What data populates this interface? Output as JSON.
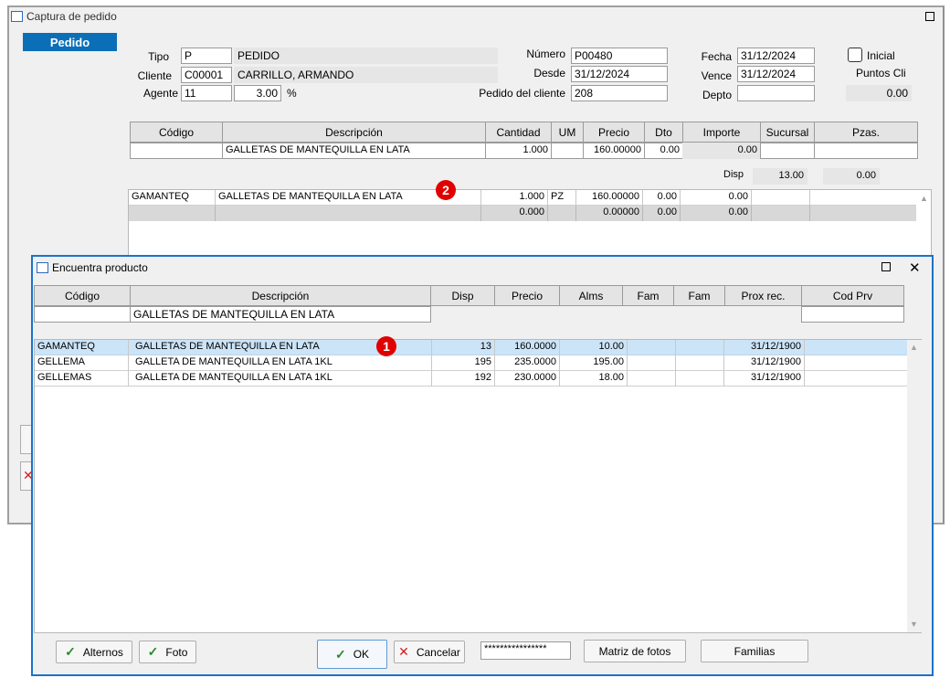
{
  "back_window": {
    "title": "Captura de pedido",
    "pedido_button": "Pedido",
    "tipo": {
      "label": "Tipo",
      "code": "P",
      "name": "PEDIDO"
    },
    "cliente": {
      "label": "Cliente",
      "code": "C00001",
      "name": "CARRILLO, ARMANDO"
    },
    "agente": {
      "label": "Agente",
      "code": "11",
      "pct": "3.00",
      "pct_sign": "%"
    },
    "numero": {
      "label": "Número",
      "value": "P00480"
    },
    "desde": {
      "label": "Desde",
      "value": "31/12/2024"
    },
    "pedido_cliente": {
      "label": "Pedido del cliente",
      "value": "208"
    },
    "fecha": {
      "label": "Fecha",
      "value": "31/12/2024"
    },
    "vence": {
      "label": "Vence",
      "value": "31/12/2024"
    },
    "depto": {
      "label": "Depto",
      "value": ""
    },
    "inicial": {
      "label": "Inicial",
      "checked": false
    },
    "puntos": {
      "label": "Puntos Cli",
      "value": "0.00"
    },
    "grid_headers": [
      "Código",
      "Descripción",
      "Cantidad",
      "UM",
      "Precio",
      "Dto",
      "Importe",
      "Sucursal",
      "Pzas."
    ],
    "entry_row": {
      "codigo": "",
      "descripcion": "GALLETAS  DE MANTEQUILLA EN LATA",
      "cantidad": "1.000",
      "um": "",
      "precio": "160.00000",
      "dto": "0.00",
      "importe": "0.00",
      "sucursal": "",
      "pzas": ""
    },
    "disp": {
      "label": "Disp",
      "value1": "13.00",
      "value2": "0.00"
    },
    "lines": [
      {
        "codigo": "GAMANTEQ",
        "descripcion": "GALLETAS  DE MANTEQUILLA EN LATA",
        "cantidad": "1.000",
        "um": "PZ",
        "precio": "160.00000",
        "dto": "0.00",
        "importe": "0.00"
      },
      {
        "codigo": "",
        "descripcion": "",
        "cantidad": "0.000",
        "um": "",
        "precio": "0.00000",
        "dto": "0.00",
        "importe": "0.00"
      }
    ],
    "badge": "2"
  },
  "front_window": {
    "title": "Encuentra producto",
    "headers": [
      "Código",
      "Descripción",
      "Disp",
      "Precio",
      "Alms",
      "Fam",
      "Fam",
      "Prox rec.",
      "Cod Prv"
    ],
    "filter_descripcion": "GALLETAS  DE MANTEQUILLA EN LATA",
    "rows": [
      {
        "codigo": "GAMANTEQ",
        "descripcion": "GALLETAS  DE MANTEQUILLA EN LATA",
        "disp": "13",
        "precio": "160.0000",
        "alms": "10.00",
        "fam1": "",
        "fam2": "",
        "prox": "31/12/1900",
        "codprv": ""
      },
      {
        "codigo": "GELLEMA",
        "descripcion": "GALLETA DE MANTEQUILLA EN LATA 1KL",
        "disp": "195",
        "precio": "235.0000",
        "alms": "195.00",
        "fam1": "",
        "fam2": "",
        "prox": "31/12/1900",
        "codprv": ""
      },
      {
        "codigo": "GELLEMAS",
        "descripcion": "GALLETA DE MANTEQUILLA EN LATA 1KL",
        "disp": "192",
        "precio": "230.0000",
        "alms": "18.00",
        "fam1": "",
        "fam2": "",
        "prox": "31/12/1900",
        "codprv": ""
      }
    ],
    "badge": "1",
    "buttons": {
      "alternos": "Alternos",
      "foto": "Foto",
      "ok": "OK",
      "cancelar": "Cancelar",
      "password": "****************",
      "matriz": "Matriz de fotos",
      "familias": "Familias"
    }
  },
  "colors": {
    "accent": "#0b6fb8",
    "selected_row": "#cce4f7",
    "badge": "#e00000",
    "front_border": "#1a73c8"
  }
}
